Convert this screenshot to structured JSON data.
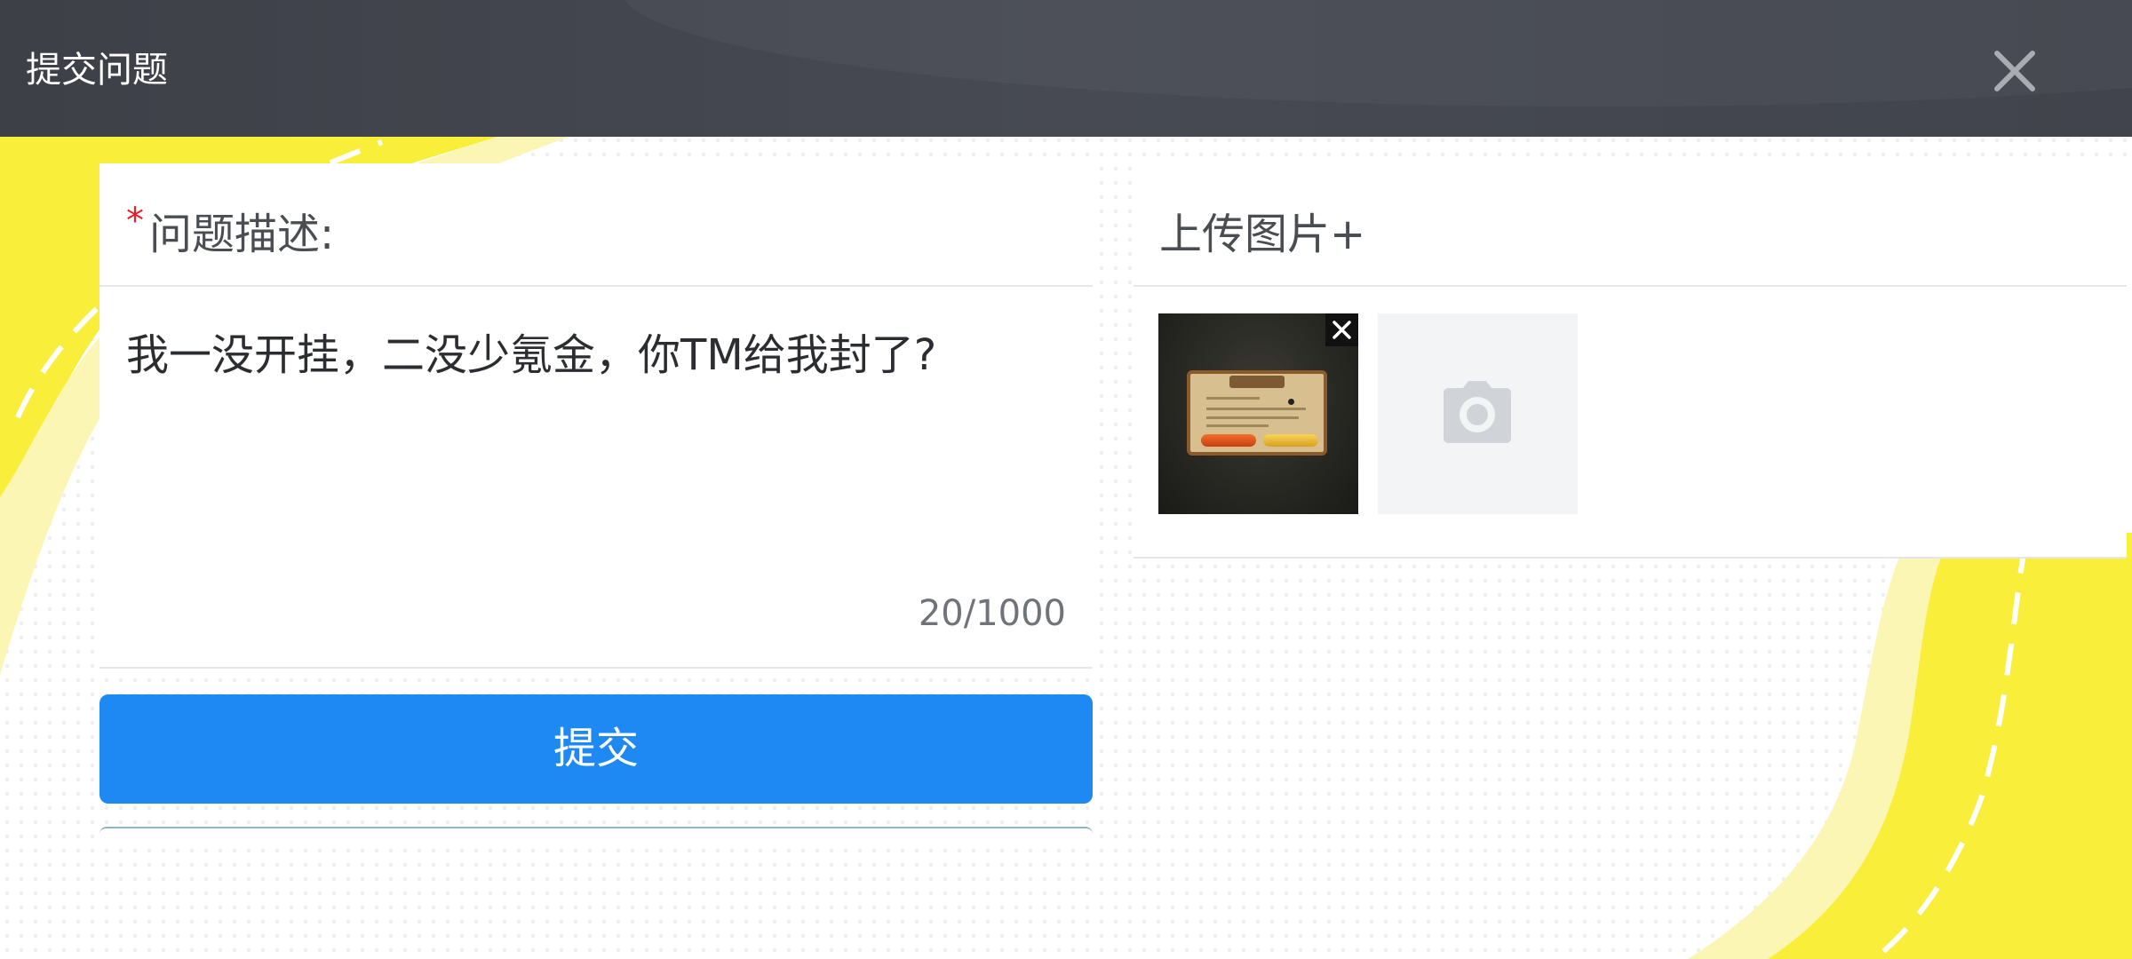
{
  "header": {
    "title": "提交问题",
    "close_icon": "close-icon",
    "background": "#3f424a"
  },
  "description": {
    "required_mark": "*",
    "label": "问题描述:",
    "value": "我一没开挂，二没少氪金，你TM给我封了?",
    "char_count": "20/1000"
  },
  "upload": {
    "label": "上传图片+",
    "attached_images": 1,
    "remove_icon": "close-icon",
    "add_icon": "camera-icon"
  },
  "submit": {
    "label": "提交",
    "color": "#1e88f3"
  },
  "colors": {
    "accent_yellow": "#f9ee3a",
    "required": "#e6202b"
  }
}
